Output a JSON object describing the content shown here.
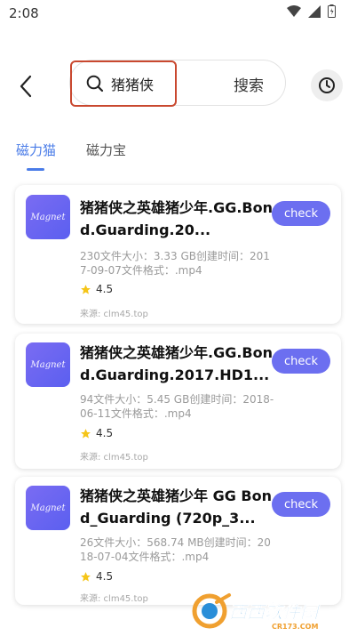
{
  "status_bar": {
    "time": "2:08"
  },
  "search": {
    "query": "猪猪侠",
    "button_label": "搜索"
  },
  "tabs": [
    {
      "label": "磁力猫",
      "active": true
    },
    {
      "label": "磁力宝",
      "active": false
    }
  ],
  "colors": {
    "accent": "#4a7ce8",
    "check_button": "#6c6ff0",
    "highlight_border": "#c9482f",
    "star": "#f5c518"
  },
  "results": [
    {
      "logo_text": "Magnet",
      "title": "猪猪侠之英雄猪少年.GG.Bond.Guarding.20...",
      "meta": "230文件大小：3.33 GB创建时间：2017-09-07文件格式：.mp4",
      "rating": "4.5",
      "source": "来源: clm45.top",
      "check_label": "check"
    },
    {
      "logo_text": "Magnet",
      "title": "猪猪侠之英雄猪少年.GG.Bond.Guarding.2017.HD1...",
      "meta": "94文件大小：5.45 GB创建时间：2018-06-11文件格式：.mp4",
      "rating": "4.5",
      "source": "来源: clm45.top",
      "check_label": "check"
    },
    {
      "logo_text": "Magnet",
      "title": "猪猪侠之英雄猪少年 GG Bond_Guarding (720p_3...",
      "meta": "26文件大小：568.74 MB创建时间：2018-07-04文件格式：.mp4",
      "rating": "4.5",
      "source": "来源: clm45.top",
      "check_label": "check"
    }
  ],
  "watermark": {
    "text": "西西软件园",
    "sub": "CR173.COM"
  }
}
